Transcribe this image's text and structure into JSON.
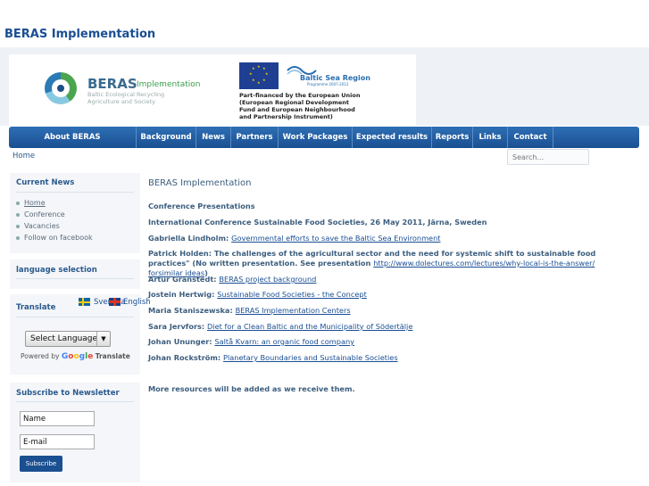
{
  "site": {
    "title": "BERAS Implementation"
  },
  "banner": {
    "brand": "BERAS",
    "brand_suffix": "Implementation",
    "brand_sub": "Baltic Ecological Recycling Agriculture and Society",
    "bsr_title": "Baltic Sea Region",
    "bsr_sub": "Programme 2007-2013",
    "eu_text": "Part-financed by the European Union (European Regional Development Fund and European Neighbourhood and Partnership Instrument)"
  },
  "nav": [
    "About BERAS Implementation",
    "Background",
    "News",
    "Partners",
    "Work Packages",
    "Expected results",
    "Reports",
    "Links",
    "Contact"
  ],
  "breadcrumb": "Home",
  "search": {
    "placeholder": "Search..."
  },
  "sidebar": {
    "news_title": "Current News",
    "news_items": [
      "Home",
      "Conference",
      "Vacancies",
      "Follow on facebook"
    ],
    "language_title": "language selection",
    "translate_title": "Translate",
    "lang_sv": "Svenska",
    "lang_en": "English",
    "select_label": "Select Language",
    "powered_by": "Powered by",
    "google": "Google",
    "translate_word": "Translate",
    "newsletter_title": "Subscribe to Newsletter",
    "name_value": "Name",
    "email_value": "E-mail",
    "subscribe_label": "Subscribe"
  },
  "content": {
    "title": "BERAS Implementation",
    "heading": "Conference Presentations",
    "conference": "International Conference Sustainable Food Societies, 26 May 2011, Järna, Sweden",
    "items": [
      {
        "speaker": "Gabriella Lindholm:",
        "text": "",
        "link": "Governmental efforts to save the Baltic Sea Environment"
      },
      {
        "speaker": "Patrick Holden:",
        "text": " The challenges of the agricultural sector and the need for systemic shift to sustainable food practices\" (No written presentation. See presentation ",
        "link": "http://www.dolectures.com/lectures/why-local-is-the-answer/ forsimilar ideas",
        "after": ")"
      },
      {
        "speaker": "Artur Granstedt:",
        "text": "",
        "link": "BERAS project background"
      },
      {
        "speaker": "Jostein Hertwig:",
        "text": "",
        "link": "Sustainable Food Societies - the Concept"
      },
      {
        "speaker": "Maria Staniszewska:",
        "text": "",
        "link": "BERAS Implementation Centers"
      },
      {
        "speaker": "Sara Jervfors:",
        "text": "",
        "link": "Diet for a Clean Baltic and the Municipality of Södertälje"
      },
      {
        "speaker": "Johan Ununger:",
        "text": "",
        "link": "Saltå Kvarn: an organic food company"
      },
      {
        "speaker": "Johan Rockström:",
        "text": "",
        "link": "Planetary Boundaries and Sustainable Societies"
      }
    ],
    "footer_note": "More resources will be added as we receive them."
  }
}
